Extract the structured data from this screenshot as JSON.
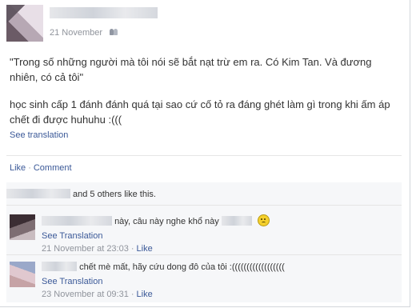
{
  "post": {
    "timestamp": "21 November",
    "privacy_icon": "friends-icon",
    "quote_text": "\"Trong số những người mà tôi nói sẽ bắt nạt trừ em ra. Có Kim Tan. Và đương\nnhiên, có cả tôi\"",
    "body_text": "học sinh cấp 1 đánh đánh quá tại sao cứ cố tỏ ra đáng ghét làm gì trong khi ấm áp\nchết đi được huhuhu :(((",
    "see_translation": "See translation"
  },
  "actions": {
    "like": "Like",
    "separator": "·",
    "comment": "Comment"
  },
  "likes": {
    "text": "and 5 others like this."
  },
  "comments": [
    {
      "text": "này, câu này nghe khổ này",
      "emoji": "smiley-icon",
      "see_translation": "See Translation",
      "time": "21 November at 23:03",
      "separator": "·",
      "like": "Like"
    },
    {
      "text": "chết mè mất, hãy cứu dong đô của tôi :((((((((((((((((((",
      "see_translation": "See Translation",
      "time": "23 November at 09:31",
      "separator": "·",
      "like": "Like"
    }
  ],
  "colors": {
    "link": "#3b5998",
    "meta": "#90949c",
    "ufi_bg": "#f6f7f9"
  }
}
